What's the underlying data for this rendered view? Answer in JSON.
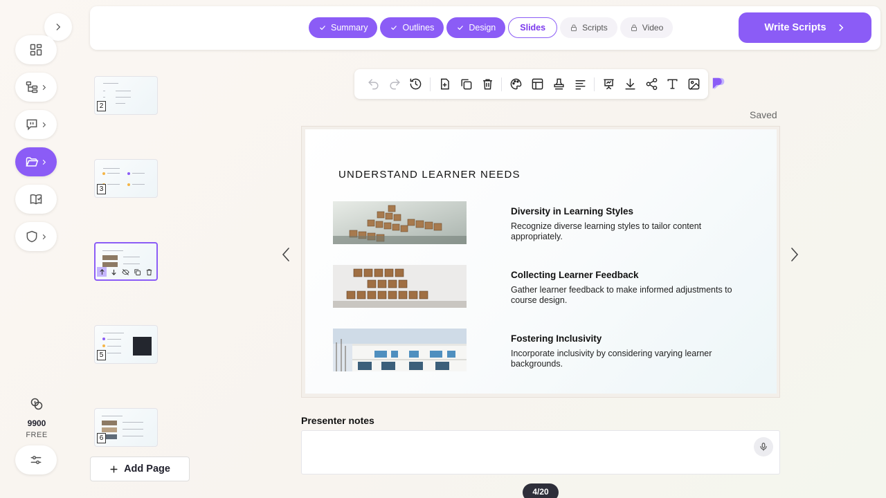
{
  "steps": [
    {
      "label": "Summary",
      "state": "done"
    },
    {
      "label": "Outlines",
      "state": "done"
    },
    {
      "label": "Design",
      "state": "done"
    },
    {
      "label": "Slides",
      "state": "current"
    },
    {
      "label": "Scripts",
      "state": "locked"
    },
    {
      "label": "Video",
      "state": "locked"
    }
  ],
  "write_scripts_label": "Write Scripts",
  "saved_status": "Saved",
  "credits": {
    "amount": "9900",
    "plan": "FREE"
  },
  "thumbnails": [
    {
      "number": "2"
    },
    {
      "number": "3"
    },
    {
      "number": ""
    },
    {
      "number": "5"
    },
    {
      "number": "6"
    }
  ],
  "add_page_label": "Add Page",
  "slide": {
    "title": "UNDERSTAND LEARNER NEEDS",
    "points": [
      {
        "title": "Diversity in Learning Styles",
        "body": "Recognize diverse learning styles to tailor content appropriately.",
        "image": "scrabble-tiles-i-am-still-learning"
      },
      {
        "title": "Collecting Learner Feedback",
        "body": "Gather learner feedback to make informed adjustments to course design.",
        "image": "scrabble-tiles-learn-from-failure"
      },
      {
        "title": "Fostering Inclusivity",
        "body": "Incorporate inclusivity by considering varying learner backgrounds.",
        "image": "modern-white-building"
      }
    ]
  },
  "presenter_notes": {
    "label": "Presenter notes",
    "value": ""
  },
  "pager": "4/20",
  "colors": {
    "accent": "#8b5cf6",
    "accent_dark": "#7c3aed",
    "pager_bg": "#2e2f3a"
  },
  "icons": {
    "rail": [
      "chevron-right-icon",
      "dashboard-icon",
      "outline-tree-icon",
      "script-chat-icon",
      "folder-open-icon",
      "book-check-icon",
      "shield-icon",
      "coins-icon",
      "sliders-icon"
    ],
    "toolbar": [
      "undo-icon",
      "redo-icon",
      "history-icon",
      "add-page-icon",
      "duplicate-icon",
      "delete-icon",
      "palette-icon",
      "layout-icon",
      "stamp-icon",
      "align-icon",
      "present-icon",
      "download-icon",
      "share-icon",
      "text-icon",
      "image-icon",
      "ai-assistant-icon"
    ]
  }
}
